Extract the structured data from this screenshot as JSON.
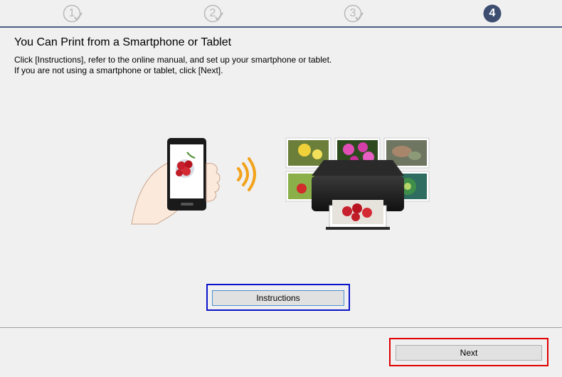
{
  "steps": [
    {
      "label": "1",
      "state": "done",
      "icon": "step-complete-icon"
    },
    {
      "label": "2",
      "state": "done",
      "icon": "step-complete-icon"
    },
    {
      "label": "3",
      "state": "done",
      "icon": "step-complete-icon"
    },
    {
      "label": "4",
      "state": "current",
      "icon": "step-current-icon"
    }
  ],
  "colors": {
    "accent": "#3c4d70",
    "done": "#b8b8b8",
    "instructions_highlight": "#0a14c8",
    "next_highlight": "#e00000"
  },
  "page": {
    "title": "You Can Print from a Smartphone or Tablet",
    "desc_line1": "Click [Instructions], refer to the online manual, and set up your smartphone or tablet.",
    "desc_line2": "If you are not using a smartphone or tablet, click [Next]."
  },
  "illustration": {
    "icons": [
      "hand-holding-smartphone-icon",
      "wireless-signal-icon",
      "printer-icon",
      "photo-thumbnails-icon"
    ]
  },
  "buttons": {
    "instructions": "Instructions",
    "next": "Next"
  }
}
